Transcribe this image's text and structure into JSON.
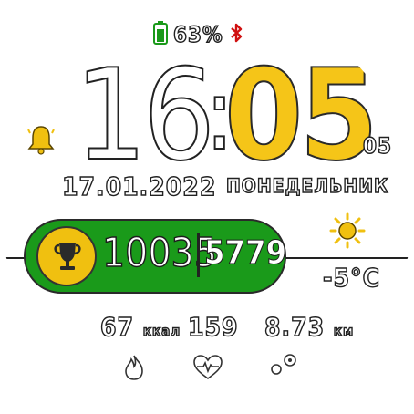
{
  "status": {
    "battery_percent": "63%",
    "colors": {
      "battery": "#1a9a1a",
      "bluetooth": "#d01010"
    }
  },
  "time": {
    "hour": "16",
    "colon": ":",
    "minute": "05",
    "seconds": "05"
  },
  "date": {
    "date": "17.01.2022",
    "weekday": "ПОНЕДЕЛЬНИК"
  },
  "steps": {
    "count": "10035",
    "goal": "5779"
  },
  "weather": {
    "temperature": "-5°C",
    "icon": "sun-icon"
  },
  "stats": {
    "calories": {
      "value": "67",
      "unit": "ккал",
      "icon": "flame-icon"
    },
    "heart_rate": {
      "value": "159",
      "icon": "heart-pulse-icon"
    },
    "distance": {
      "value": "8.73",
      "unit": "км",
      "icon": "footprints-icon"
    }
  },
  "icons": [
    "battery-icon",
    "bluetooth-icon",
    "alarm-bell-icon",
    "trophy-icon",
    "sun-icon",
    "flame-icon",
    "heart-pulse-icon",
    "footprints-icon"
  ],
  "colors": {
    "accent": "#f5c518",
    "green": "#1a9a1a",
    "outline": "#222222"
  }
}
